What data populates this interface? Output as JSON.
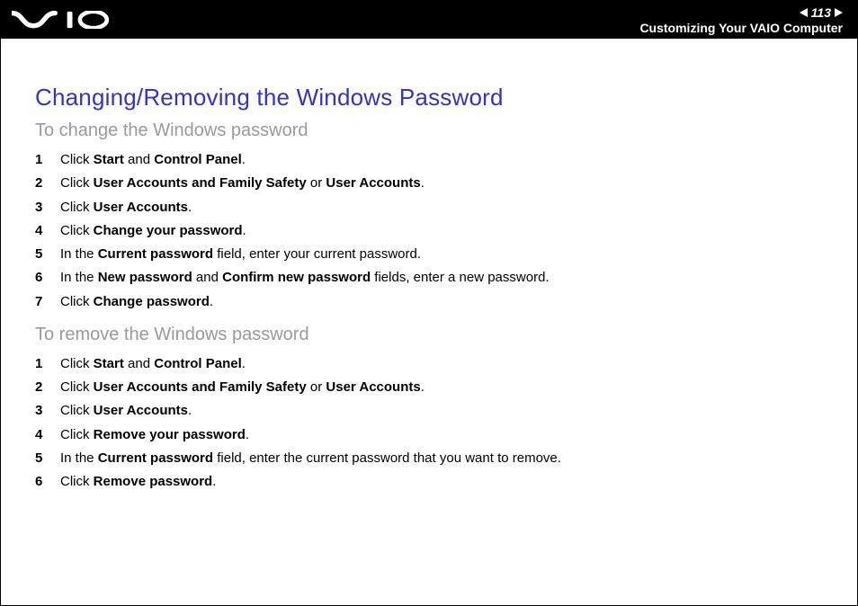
{
  "header": {
    "page_number": "113",
    "section": "Customizing Your VAIO Computer"
  },
  "title": "Changing/Removing the Windows Password",
  "sections": [
    {
      "heading": "To change the Windows password",
      "steps": [
        {
          "n": "1",
          "html": "Click <b>Start</b> and <b>Control Panel</b>."
        },
        {
          "n": "2",
          "html": "Click <b>User Accounts and Family Safety</b> or <b>User Accounts</b>."
        },
        {
          "n": "3",
          "html": "Click <b>User Accounts</b>."
        },
        {
          "n": "4",
          "html": "Click <b>Change your password</b>."
        },
        {
          "n": "5",
          "html": "In the <b>Current password</b> field, enter your current password."
        },
        {
          "n": "6",
          "html": "In the <b>New password</b> and <b>Confirm new password</b> fields, enter a new password."
        },
        {
          "n": "7",
          "html": "Click <b>Change password</b>."
        }
      ]
    },
    {
      "heading": "To remove the Windows password",
      "steps": [
        {
          "n": "1",
          "html": "Click <b>Start</b> and <b>Control Panel</b>."
        },
        {
          "n": "2",
          "html": "Click <b>User Accounts and Family Safety</b> or <b>User Accounts</b>."
        },
        {
          "n": "3",
          "html": "Click <b>User Accounts</b>."
        },
        {
          "n": "4",
          "html": "Click <b>Remove your password</b>."
        },
        {
          "n": "5",
          "html": "In the <b>Current password</b> field, enter the current password that you want to remove."
        },
        {
          "n": "6",
          "html": "Click <b>Remove password</b>."
        }
      ]
    }
  ]
}
